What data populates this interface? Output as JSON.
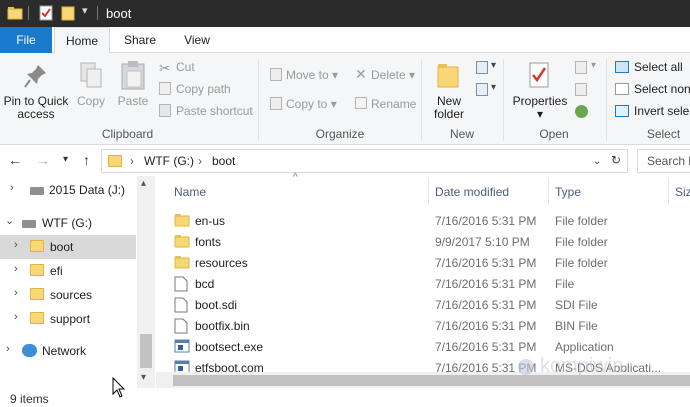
{
  "window": {
    "title": "boot"
  },
  "tabs": {
    "file": "File",
    "home": "Home",
    "share": "Share",
    "view": "View"
  },
  "ribbon": {
    "pin": "Pin to Quick access",
    "copy": "Copy",
    "paste": "Paste",
    "cut": "Cut",
    "copy_path": "Copy path",
    "paste_shortcut": "Paste shortcut",
    "clipboard_label": "Clipboard",
    "move_to": "Move to",
    "copy_to": "Copy to",
    "delete": "Delete",
    "rename": "Rename",
    "organize_label": "Organize",
    "new_folder_line1": "New",
    "new_folder_line2": "folder",
    "new_label": "New",
    "properties": "Properties",
    "open_label": "Open",
    "select_all": "Select all",
    "select_none": "Select none",
    "invert_selection": "Invert selection",
    "select_label": "Select"
  },
  "address": {
    "crumbs": [
      "WTF (G:)",
      "boot"
    ],
    "search_placeholder": "Search boot"
  },
  "nav": {
    "items": [
      {
        "label": "2015 Data (J:)"
      },
      {
        "label": "WTF (G:)"
      },
      {
        "label": "boot"
      },
      {
        "label": "efi"
      },
      {
        "label": "sources"
      },
      {
        "label": "support"
      },
      {
        "label": "Network"
      }
    ]
  },
  "columns": {
    "name": "Name",
    "date": "Date modified",
    "type": "Type",
    "size": "Size"
  },
  "files": [
    {
      "name": "en-us",
      "date": "7/16/2016 5:31 PM",
      "type": "File folder",
      "icon": "folder-icon"
    },
    {
      "name": "fonts",
      "date": "9/9/2017 5:10 PM",
      "type": "File folder",
      "icon": "folder-icon"
    },
    {
      "name": "resources",
      "date": "7/16/2016 5:31 PM",
      "type": "File folder",
      "icon": "folder-icon"
    },
    {
      "name": "bcd",
      "date": "7/16/2016 5:31 PM",
      "type": "File",
      "icon": "file-icon"
    },
    {
      "name": "boot.sdi",
      "date": "7/16/2016 5:31 PM",
      "type": "SDI File",
      "icon": "file-icon"
    },
    {
      "name": "bootfix.bin",
      "date": "7/16/2016 5:31 PM",
      "type": "BIN File",
      "icon": "file-icon"
    },
    {
      "name": "bootsect.exe",
      "date": "7/16/2016 5:31 PM",
      "type": "Application",
      "icon": "app-icon"
    },
    {
      "name": "etfsboot.com",
      "date": "7/16/2016 5:31 PM",
      "type": "MS-DOS Applicati...",
      "icon": "app-icon"
    }
  ],
  "status": {
    "count": "9 items"
  },
  "watermark": "kompiwin",
  "colors": {
    "accent": "#1979ca",
    "titlebar": "#2b2b2b",
    "folder": "#f8d775",
    "selection": "#d9d9d9"
  }
}
